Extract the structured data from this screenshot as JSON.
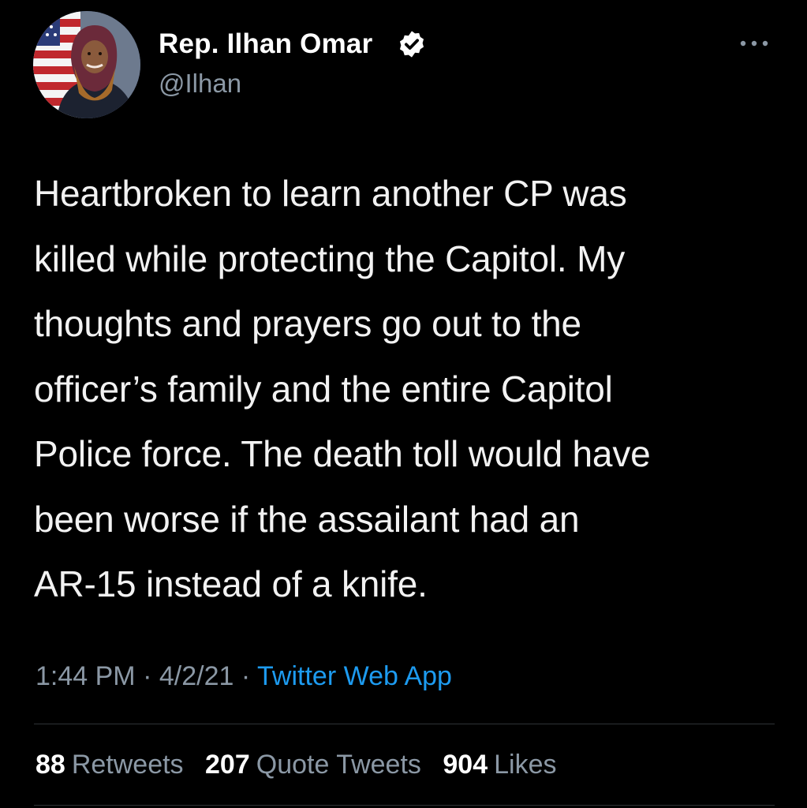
{
  "author": {
    "name": "Rep. Ilhan Omar",
    "handle": "@Ilhan",
    "verified": true
  },
  "tweet": {
    "lines": [
      "Heartbroken to learn another CP was",
      "killed while protecting the Capitol. My",
      "thoughts and prayers go out to the",
      "officer’s family and the entire Capitol",
      "Police force. The death toll would have",
      "been worse if the assailant had an",
      "AR-15 instead of a knife."
    ]
  },
  "meta": {
    "time": "1:44 PM",
    "separator": "·",
    "date": "4/2/21",
    "source": "Twitter Web App"
  },
  "stats": {
    "retweets_count": "88",
    "retweets_label": "Retweets",
    "quotes_count": "207",
    "quotes_label": "Quote Tweets",
    "likes_count": "904",
    "likes_label": "Likes"
  },
  "colors": {
    "background": "#000000",
    "text": "#f2f2f2",
    "secondary": "#8b98a5",
    "accent": "#1d9bf0",
    "divider": "#2f3336"
  },
  "icons": {
    "more": "more-horizontal-icon",
    "verified": "verified-badge-icon"
  }
}
